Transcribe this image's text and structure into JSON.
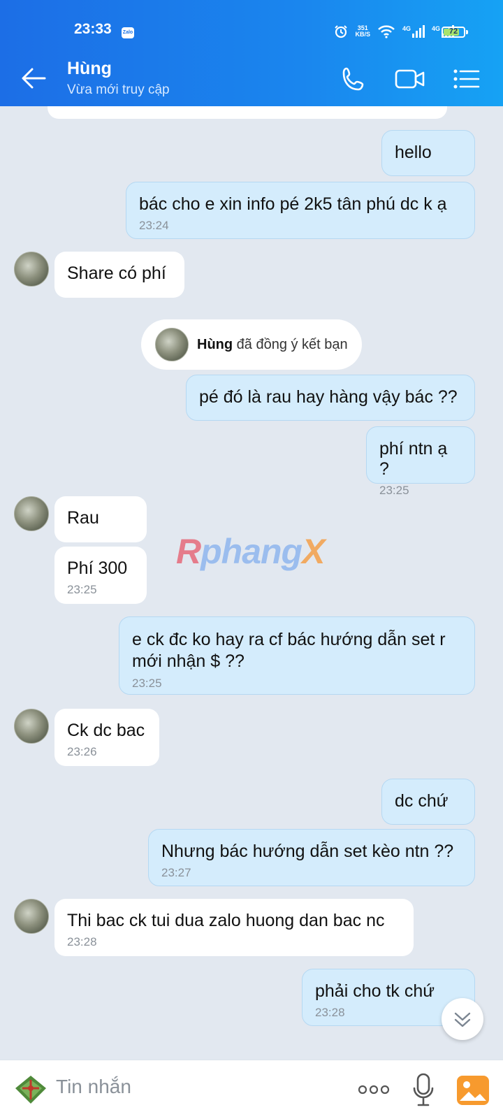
{
  "status_bar": {
    "time": "23:33",
    "app_badge": "Zalo",
    "net_speed_top": "351",
    "net_speed_bottom": "KB/S",
    "signal1": "4G",
    "signal2": "4G",
    "battery": "72"
  },
  "header": {
    "contact_name": "Hùng",
    "status": "Vừa mới truy cập"
  },
  "messages": [
    {
      "dir": "out",
      "text": "hello",
      "time": ""
    },
    {
      "dir": "out",
      "text": "bác cho e xin info pé 2k5 tân phú dc k ạ",
      "time": "23:24"
    },
    {
      "dir": "in",
      "text": "Share có phí",
      "time": ""
    },
    {
      "dir": "out",
      "text": "pé đó là rau hay hàng vậy bác ??",
      "time": ""
    },
    {
      "dir": "out",
      "text": "phí ntn ạ ?",
      "time": "23:25"
    },
    {
      "dir": "in",
      "text": "Rau",
      "time": ""
    },
    {
      "dir": "in",
      "text": "Phí 300",
      "time": "23:25"
    },
    {
      "dir": "out",
      "text": "e ck đc ko hay ra cf bác hướng dẫn set r mới nhận $ ??",
      "time": "23:25"
    },
    {
      "dir": "in",
      "text": "Ck dc bac",
      "time": "23:26"
    },
    {
      "dir": "out",
      "text": "dc chứ",
      "time": ""
    },
    {
      "dir": "out",
      "text": "Nhưng bác hướng dẫn set kèo ntn ??",
      "time": "23:27"
    },
    {
      "dir": "in",
      "text": "Thi bac ck tui dua zalo huong dan bac nc",
      "time": "23:28"
    },
    {
      "dir": "out",
      "text": "phải cho tk chứ",
      "time": "23:28"
    }
  ],
  "system_message": {
    "name": "Hùng",
    "text": " đã đồng ý kết bạn"
  },
  "watermark": {
    "part1": "R",
    "part2": "phang",
    "part3": "X"
  },
  "input": {
    "placeholder": "Tin nhắn"
  },
  "colors": {
    "header_start": "#1c6ee6",
    "header_end": "#16a2f4",
    "outgoing_bubble": "#d4ecfc",
    "incoming_bubble": "#ffffff",
    "chat_background": "#e2e8f0"
  }
}
